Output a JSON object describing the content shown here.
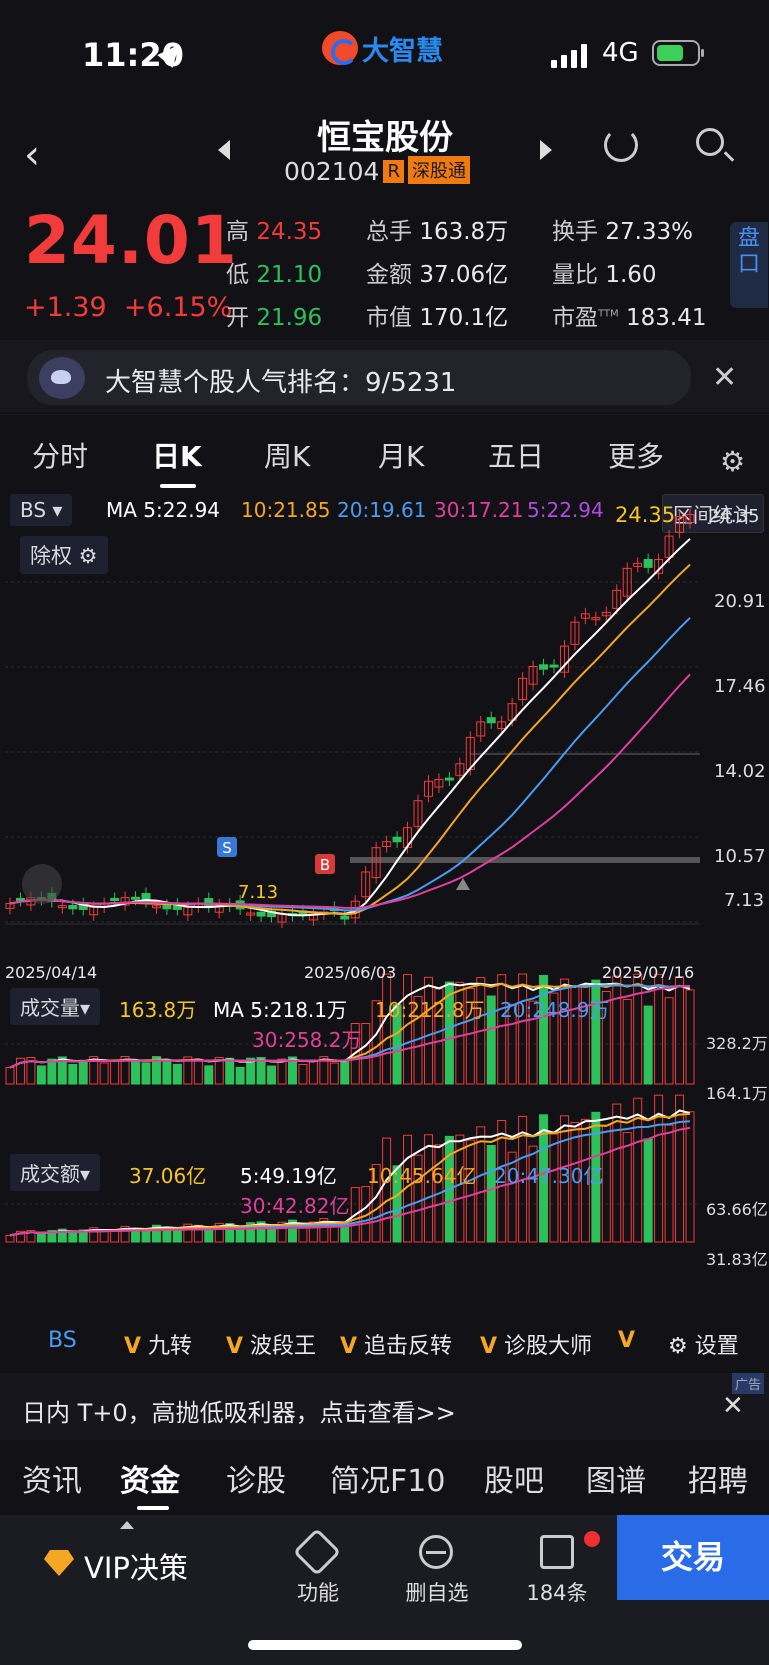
{
  "status_bar": {
    "time": "11:20",
    "network": "4G",
    "app_logo_text": "大智慧"
  },
  "header": {
    "name": "恒宝股份",
    "code": "002104",
    "tag_r": "R",
    "tag_exchange": "深股通"
  },
  "quote": {
    "price": "24.01",
    "change": "+1.39",
    "change_pct": "+6.15%",
    "high_label": "高",
    "high": "24.35",
    "low_label": "低",
    "low": "21.10",
    "open_label": "开",
    "open": "21.96",
    "volume_label": "总手",
    "volume": "163.8万",
    "amount_label": "金额",
    "amount": "37.06亿",
    "mktcap_label": "市值",
    "mktcap": "170.1亿",
    "turnover_label": "换手",
    "turnover": "27.33%",
    "vol_ratio_label": "量比",
    "vol_ratio": "1.60",
    "pe_label": "市盈",
    "pe_sup": "TTM",
    "pe": "183.41",
    "pankou": "盘口"
  },
  "banner": {
    "text": "大智慧个股人气排名：9/5231"
  },
  "tabs": [
    "分时",
    "日K",
    "周K",
    "月K",
    "五日",
    "更多"
  ],
  "kline": {
    "bs_label": "BS",
    "ma_label": "MA 5:22.94",
    "ma10": "10:21.85",
    "ma20": "20:19.61",
    "ma30": "30:17.21",
    "ma5b": "5:22.94",
    "interval_stats": "区间统计",
    "chuquan": "除权",
    "high_marker": "24.35",
    "low_marker": "7.13",
    "y_ticks": [
      "24.35",
      "20.91",
      "17.46",
      "14.02",
      "10.57",
      "7.13"
    ],
    "dates": [
      "2025/04/14",
      "2025/06/03",
      "2025/07/16"
    ],
    "sell_mark": "S",
    "buy_mark": "B"
  },
  "volume_panel": {
    "title": "成交量",
    "value": "163.8万",
    "ma5": "MA 5:218.1万",
    "ma10": "10:212.8万",
    "ma20": "20:248.9万",
    "ma30": "30:258.2万",
    "y_top": "328.2万",
    "y_mid": "164.1万"
  },
  "amount_panel": {
    "title": "成交额",
    "value": "37.06亿",
    "ma5": "5:49.19亿",
    "ma10": "10:45.64亿",
    "ma20": "20:47.30亿",
    "ma30": "30:42.82亿",
    "y_top": "63.66亿",
    "y_mid": "31.83亿"
  },
  "indicator_bar": {
    "items": [
      "BS",
      "九转",
      "波段王",
      "追击反转",
      "诊股大师"
    ],
    "settings": "设置"
  },
  "ad": {
    "text": "日内 T+0，高抛低吸利器，点击查看>>",
    "badge": "广告"
  },
  "bottom_tabs": [
    "资讯",
    "资金",
    "诊股",
    "简况F10",
    "股吧",
    "图谱",
    "招聘"
  ],
  "footer": {
    "vip": "VIP决策",
    "func": "功能",
    "remove": "删自选",
    "count": "184条",
    "trade": "交易"
  },
  "colors": {
    "up": "#f23b3b",
    "down": "#2cc15a",
    "ma5": "#ffffff",
    "ma10": "#f5a623",
    "ma20": "#4a9cf0",
    "ma30": "#e0409a"
  }
}
